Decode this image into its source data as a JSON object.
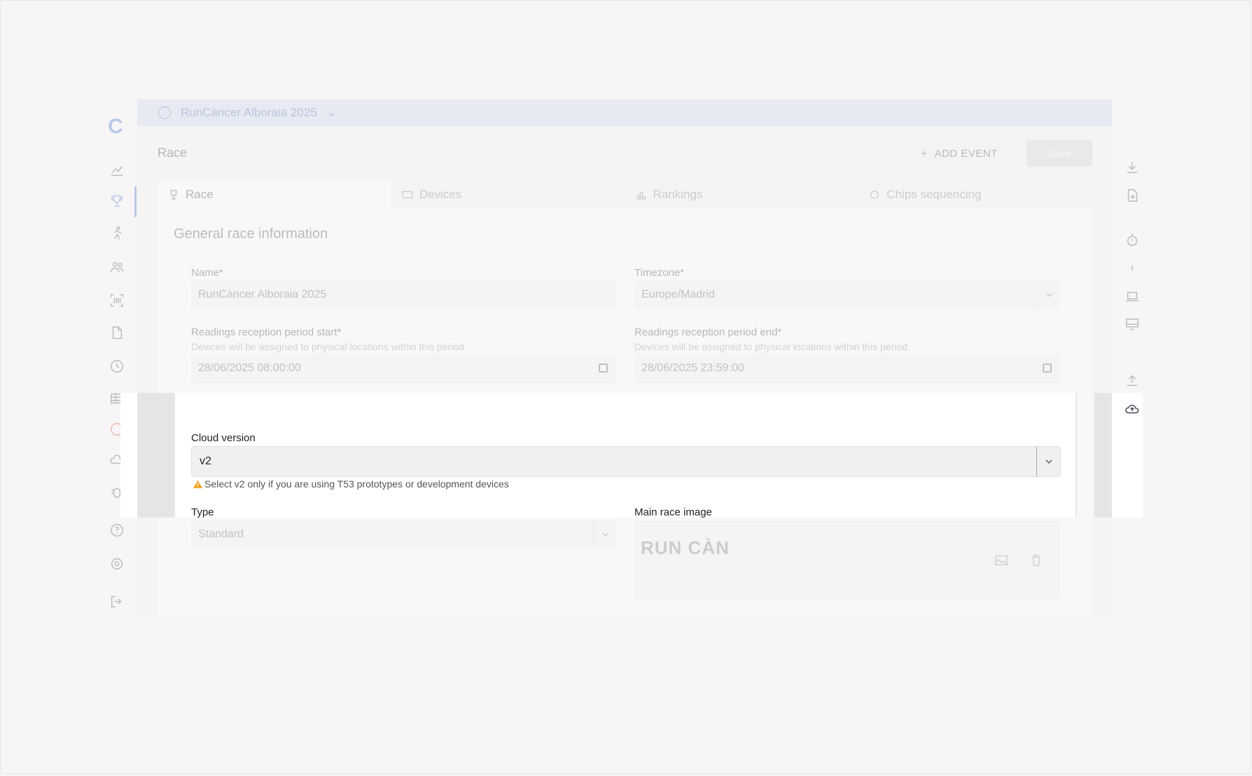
{
  "header": {
    "race_selector": "RunCàncer Alboraia 2025"
  },
  "page": {
    "title": "Race",
    "add_event_label": "ADD EVENT",
    "save_label": "Save"
  },
  "tabs": [
    {
      "label": "Race",
      "icon": "trophy-icon"
    },
    {
      "label": "Devices",
      "icon": "devices-icon"
    },
    {
      "label": "Rankings",
      "icon": "podium-icon"
    },
    {
      "label": "Chips sequencing",
      "icon": "gear-icon"
    }
  ],
  "section": {
    "title": "General race information"
  },
  "form": {
    "name_label": "Name*",
    "name_value": "RunCàncer Alboraia 2025",
    "timezone_label": "Timezone*",
    "timezone_value": "Europe/Madrid",
    "start_label": "Readings reception period start*",
    "start_hint": "Devices will be assigned to physical locations within this period.",
    "start_value": "28/06/2025 08:00:00",
    "end_label": "Readings reception period end*",
    "end_hint": "Devices will be assigned to physical locations within this period.",
    "end_value": "28/06/2025 23:59:00",
    "cloud_label": "Cloud version",
    "cloud_value": "v2",
    "cloud_warning": "Select v2 only if you are using T53 prototypes or development devices",
    "type_label": "Type",
    "type_value": "Standard",
    "image_label": "Main race image",
    "image_logo_text": "RUN CÀN"
  },
  "colors": {
    "accent": "#3b6fd6",
    "topbar": "#c6d6f1",
    "warning": "#f0a020"
  }
}
